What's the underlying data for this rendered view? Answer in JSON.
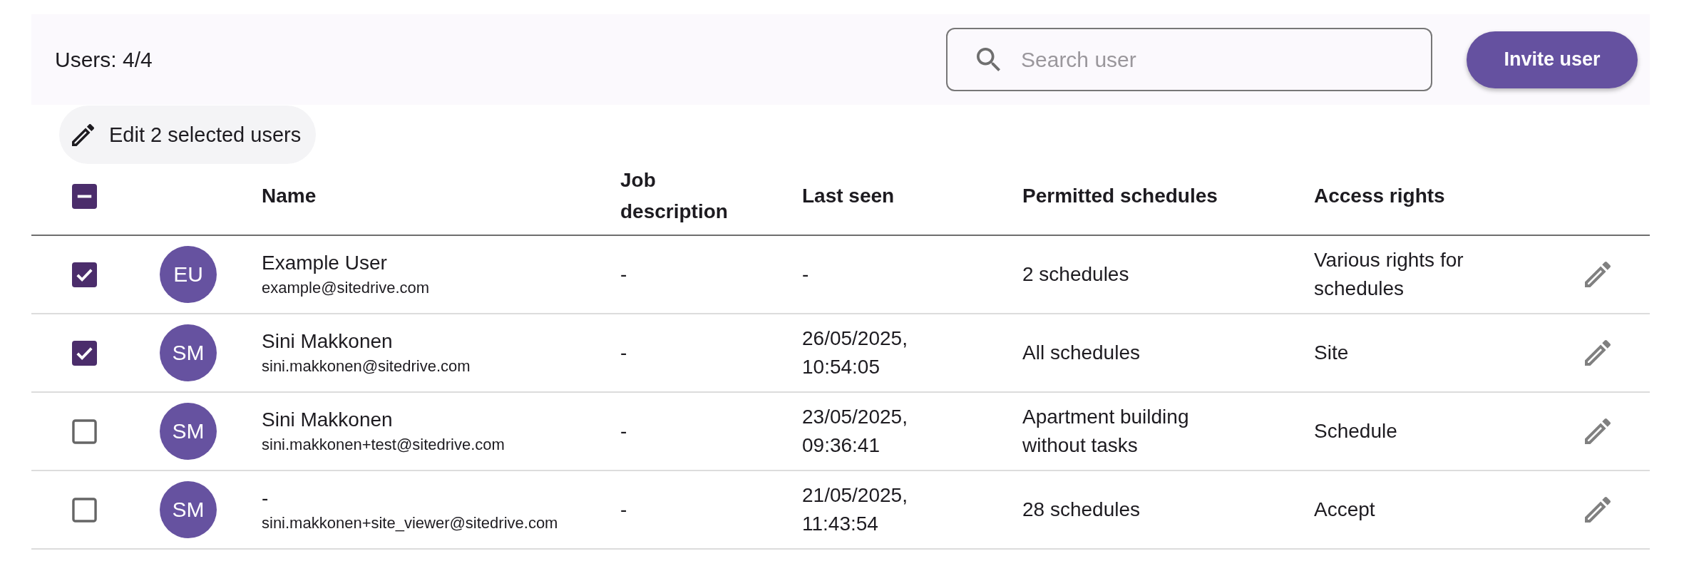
{
  "toolbar": {
    "user_count": "Users: 4/4",
    "search": {
      "placeholder": "Search user"
    },
    "invite_button": {
      "label": "Invite user"
    }
  },
  "bulk_edit_button": {
    "label": "Edit 2 selected users"
  },
  "table": {
    "select_all": {
      "indeterminate": true
    },
    "columns": [
      "Name",
      "Job description",
      "Last seen",
      "Permitted schedules",
      "Access rights"
    ],
    "rows": [
      {
        "selected": true,
        "initials": "EU",
        "name": "Example User",
        "email": "example@sitedrive.com",
        "job_description": "-",
        "last_seen": "-",
        "permitted_schedules": "2 schedules",
        "access_rights": "Various rights for schedules"
      },
      {
        "selected": true,
        "initials": "SM",
        "name": "Sini Makkonen",
        "email": "sini.makkonen@sitedrive.com",
        "job_description": "-",
        "last_seen": "26/05/2025, 10:54:05",
        "permitted_schedules": "All schedules",
        "access_rights": "Site"
      },
      {
        "selected": false,
        "initials": "SM",
        "name": "Sini Makkonen",
        "email": "sini.makkonen+test@sitedrive.com",
        "job_description": "-",
        "last_seen": "23/05/2025, 09:36:41",
        "permitted_schedules": "Apartment building without tasks",
        "access_rights": "Schedule"
      },
      {
        "selected": false,
        "initials": "SM",
        "name": "-",
        "email": "sini.makkonen+site_viewer@sitedrive.com",
        "job_description": "-",
        "last_seen": "21/05/2025, 11:43:54",
        "permitted_schedules": "28 schedules",
        "access_rights": "Accept"
      }
    ]
  }
}
